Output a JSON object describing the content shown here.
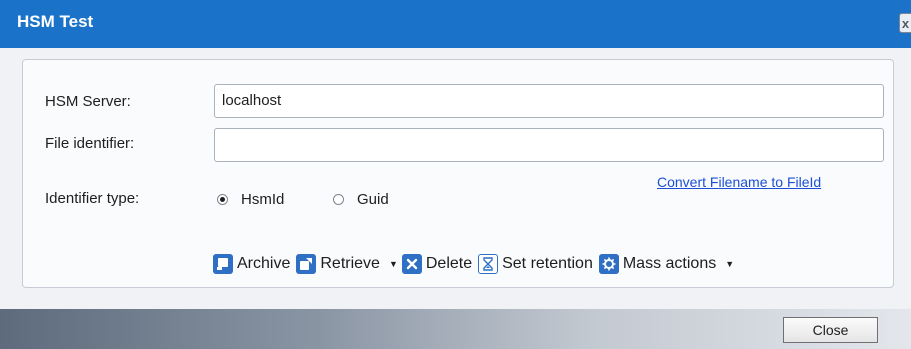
{
  "window": {
    "title": "HSM Test",
    "close_glyph": "x"
  },
  "form": {
    "server_label": "HSM Server:",
    "server_value": "localhost",
    "file_id_label": "File identifier:",
    "file_id_value": "",
    "id_type_label": "Identifier type:",
    "id_type_options": [
      {
        "label": "HsmId",
        "checked": true
      },
      {
        "label": "Guid",
        "checked": false
      }
    ],
    "convert_link": "Convert Filename to FileId"
  },
  "toolbar": {
    "archive": "Archive",
    "retrieve": "Retrieve",
    "delete": "Delete",
    "set_retention": "Set retention",
    "mass_actions": "Mass actions",
    "dropdown_glyph": "▼"
  },
  "footer": {
    "close_label": "Close"
  },
  "colors": {
    "title_bar": "#1a73c8",
    "link": "#1b4fd6",
    "icon_blue": "#2f6fc4"
  }
}
